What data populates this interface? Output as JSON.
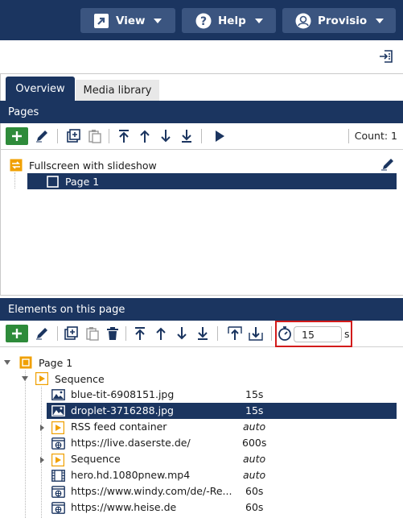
{
  "topbar": {
    "view_label": "View",
    "help_label": "Help",
    "user_label": "Provisio"
  },
  "tabs": [
    {
      "label": "Overview",
      "active": true
    },
    {
      "label": "Media library",
      "active": false
    }
  ],
  "pages_section": {
    "title": "Pages",
    "count_label": "Count: 1",
    "tree": {
      "root_label": "Fullscreen with slideshow",
      "children": [
        {
          "label": "Page 1",
          "selected": true
        }
      ]
    }
  },
  "elements_section": {
    "title": "Elements on this page",
    "timer_value": "15",
    "timer_unit": "s",
    "tree": {
      "root_label": "Page 1",
      "sequence_label": "Sequence",
      "rows": [
        {
          "name": "blue-tit-6908151.jpg",
          "duration": "15s",
          "icon": "image-icon",
          "selected": false
        },
        {
          "name": "droplet-3716288.jpg",
          "duration": "15s",
          "icon": "image-icon",
          "selected": true
        },
        {
          "name": "RSS feed container",
          "duration": "auto",
          "icon": "sequence-icon",
          "selected": false
        },
        {
          "name": "https://live.daserste.de/",
          "duration": "600s",
          "icon": "web-icon",
          "selected": false
        },
        {
          "name": "Sequence",
          "duration": "auto",
          "icon": "sequence-icon",
          "selected": false
        },
        {
          "name": "hero.hd.1080pnew.mp4",
          "duration": "auto",
          "icon": "video-icon",
          "selected": false
        },
        {
          "name": "https://www.windy.com/de/-Re...",
          "duration": "60s",
          "icon": "web-icon",
          "selected": false
        },
        {
          "name": "https://www.heise.de",
          "duration": "60s",
          "icon": "web-icon",
          "selected": false
        }
      ]
    }
  },
  "colors": {
    "navy": "#1b3560",
    "button_bg": "#3b5580",
    "add_green": "#2e8b3a",
    "orange": "#f0a000",
    "highlight_red": "#d21b1b"
  }
}
